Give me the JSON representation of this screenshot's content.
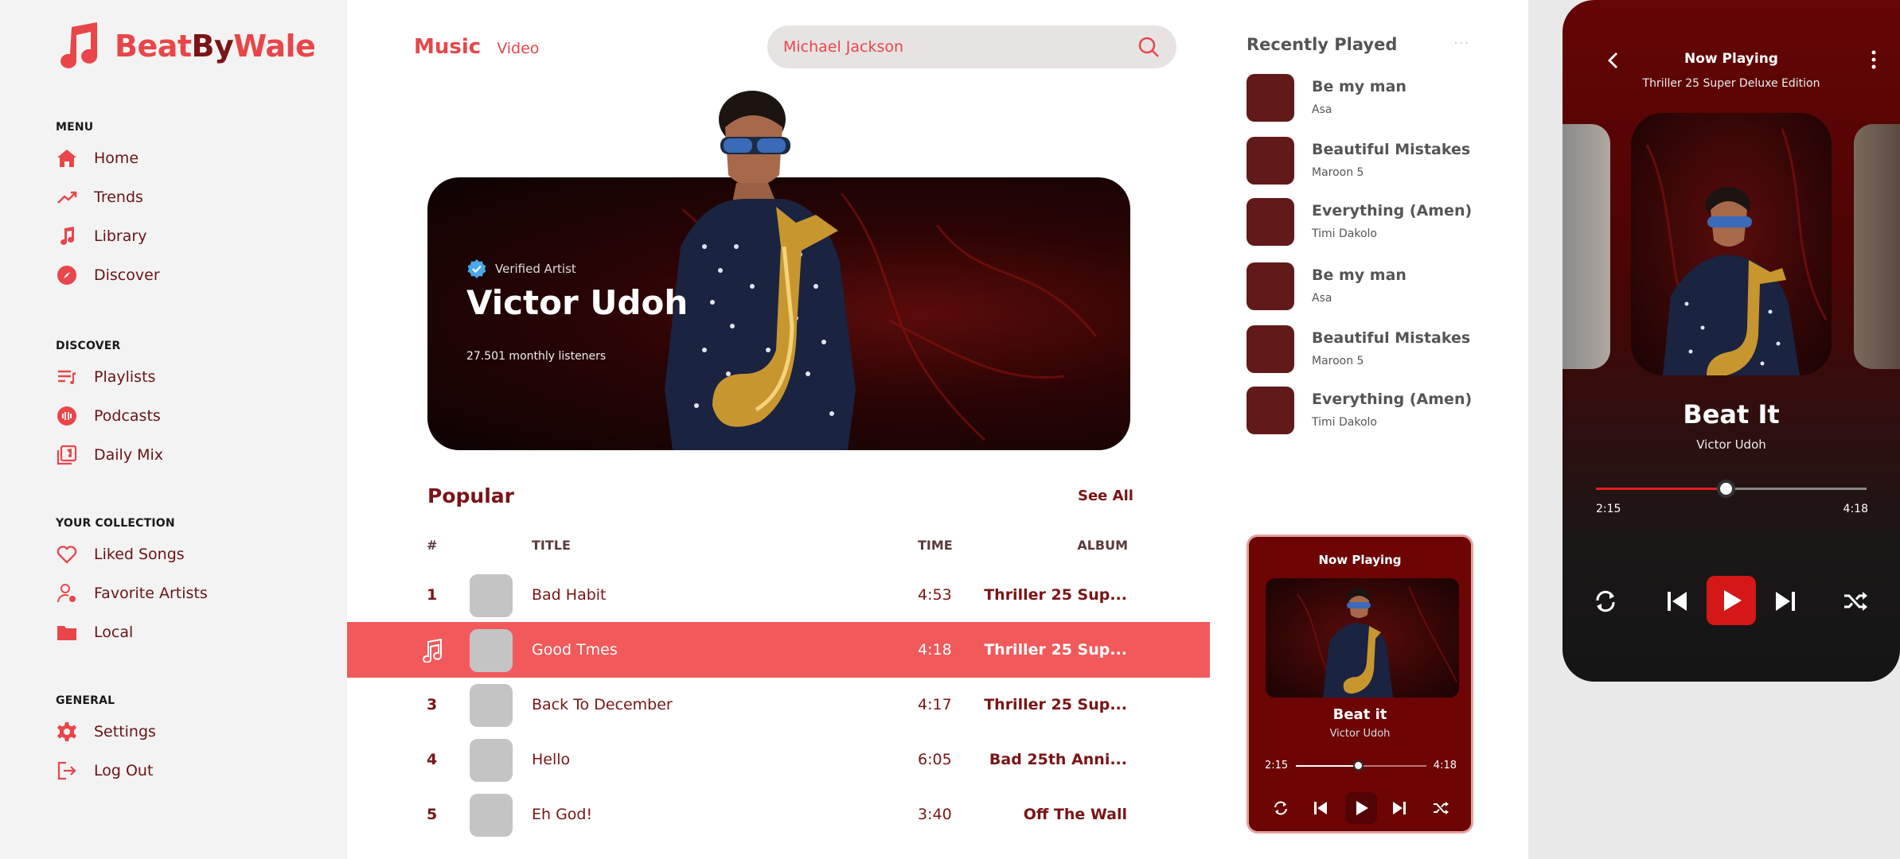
{
  "brand": {
    "part1": "Beat",
    "part2": "By",
    "part3": "Wale",
    "accent": "#e8464a",
    "dark": "#7a1416"
  },
  "menu": {
    "heading": "MENU",
    "items": [
      {
        "label": "Home",
        "icon": "home-icon"
      },
      {
        "label": "Trends",
        "icon": "trending-icon"
      },
      {
        "label": "Library",
        "icon": "music-note-icon"
      },
      {
        "label": "Discover",
        "icon": "compass-icon"
      }
    ]
  },
  "discover": {
    "heading": "DISCOVER",
    "items": [
      {
        "label": "Playlists",
        "icon": "playlist-icon"
      },
      {
        "label": "Podcasts",
        "icon": "podcast-icon"
      },
      {
        "label": "Daily Mix",
        "icon": "mix-icon"
      }
    ]
  },
  "collection": {
    "heading": "YOUR COLLECTION",
    "items": [
      {
        "label": "Liked Songs",
        "icon": "heart-icon"
      },
      {
        "label": "Favorite Artists",
        "icon": "artist-icon"
      },
      {
        "label": "Local",
        "icon": "folder-icon"
      }
    ]
  },
  "general": {
    "heading": "GENERAL",
    "items": [
      {
        "label": "Settings",
        "icon": "gear-icon"
      },
      {
        "label": "Log Out",
        "icon": "logout-icon"
      }
    ]
  },
  "tabs": {
    "music": "Music",
    "video": "Video"
  },
  "search": {
    "value": "Michael Jackson"
  },
  "hero": {
    "verified": "Verified Artist",
    "artist": "Victor Udoh",
    "listeners": "27.501 monthly listeners"
  },
  "popular": {
    "title": "Popular",
    "see_all": "See All",
    "headers": {
      "num": "#",
      "title": "TITLE",
      "time": "TIME",
      "album": "ALBUM"
    },
    "rows": [
      {
        "num": "1",
        "title": "Bad Habit",
        "time": "4:53",
        "album": "Thriller 25 Sup..."
      },
      {
        "num": "",
        "title": "Good Tmes",
        "time": "4:18",
        "album": "Thriller 25 Sup..."
      },
      {
        "num": "3",
        "title": "Back To December",
        "time": "4:17",
        "album": "Thriller 25 Sup..."
      },
      {
        "num": "4",
        "title": "Hello",
        "time": "6:05",
        "album": "Bad 25th Anni..."
      },
      {
        "num": "5",
        "title": "Eh God!",
        "time": "3:40",
        "album": "Off The Wall"
      }
    ]
  },
  "recent": {
    "title": "Recently Played",
    "items": [
      {
        "title": "Be my man",
        "artist": "Asa"
      },
      {
        "title": "Beautiful Mistakes",
        "artist": "Maroon 5"
      },
      {
        "title": "Everything (Amen)",
        "artist": "Timi Dakolo"
      },
      {
        "title": "Be my man",
        "artist": "Asa"
      },
      {
        "title": "Beautiful Mistakes",
        "artist": "Maroon 5"
      },
      {
        "title": "Everything (Amen)",
        "artist": "Timi Dakolo"
      }
    ]
  },
  "mini_player": {
    "title": "Now Playing",
    "song": "Beat it",
    "artist": "Victor Udoh",
    "elapsed": "2:15",
    "duration": "4:18",
    "progress": 0.48
  },
  "phone_player": {
    "title": "Now Playing",
    "album": "Thriller 25 Super Deluxe Edition",
    "song": "Beat It",
    "artist": "Victor Udoh",
    "elapsed": "2:15",
    "duration": "4:18",
    "progress": 0.48
  }
}
